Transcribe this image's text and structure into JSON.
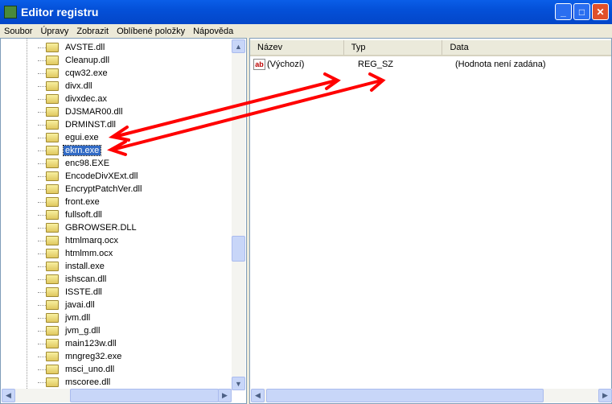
{
  "window": {
    "title": "Editor registru",
    "buttons": [
      "_",
      "□",
      "✕"
    ]
  },
  "menu": [
    "Soubor",
    "Úpravy",
    "Zobrazit",
    "Oblíbené položky",
    "Nápověda"
  ],
  "tree": {
    "items": [
      "AVSTE.dll",
      "Cleanup.dll",
      "cqw32.exe",
      "divx.dll",
      "divxdec.ax",
      "DJSMAR00.dll",
      "DRMINST.dll",
      "egui.exe",
      "ekrn.exe",
      "enc98.EXE",
      "EncodeDivXExt.dll",
      "EncryptPatchVer.dll",
      "front.exe",
      "fullsoft.dll",
      "GBROWSER.DLL",
      "htmlmarq.ocx",
      "htmlmm.ocx",
      "install.exe",
      "ishscan.dll",
      "ISSTE.dll",
      "javai.dll",
      "jvm.dll",
      "jvm_g.dll",
      "main123w.dll",
      "mngreg32.exe",
      "msci_uno.dll",
      "mscoree.dll"
    ],
    "selected": "ekrn.exe"
  },
  "values": {
    "columns": [
      "Název",
      "Typ",
      "Data"
    ],
    "rows": [
      {
        "name": "(Výchozí)",
        "type": "REG_SZ",
        "data": "(Hodnota není zadána)",
        "icon": "string-value-icon"
      }
    ]
  },
  "annotation_color": "#ff0000"
}
